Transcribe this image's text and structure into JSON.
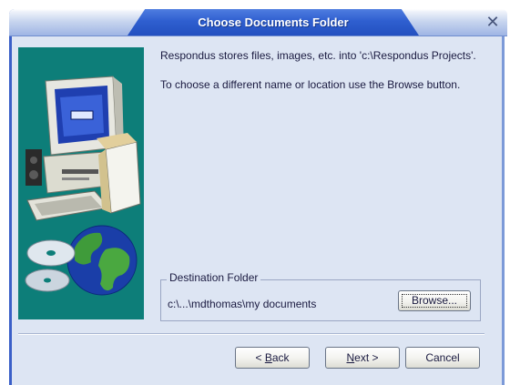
{
  "window": {
    "title": "Choose Documents Folder",
    "close_symbol": "✕"
  },
  "content": {
    "line1": "Respondus stores files, images, etc. into 'c:\\Respondus Projects'.",
    "line2": "To choose a different name or location use the Browse button."
  },
  "destination": {
    "label": "Destination Folder",
    "path": "c:\\...\\mdthomas\\my documents",
    "browse_label": "Browse..."
  },
  "buttons": {
    "back_prefix": "< ",
    "back_key": "B",
    "back_rest": "ack",
    "next_key": "N",
    "next_rest": "ext >",
    "cancel": "Cancel"
  },
  "icons": {
    "illustration": "computer-cd-globe-illustration",
    "close": "close-icon"
  },
  "colors": {
    "title_band": "#2f5fd0",
    "illustration_bg": "#0d7e79",
    "window_bg": "#dde5f3"
  }
}
